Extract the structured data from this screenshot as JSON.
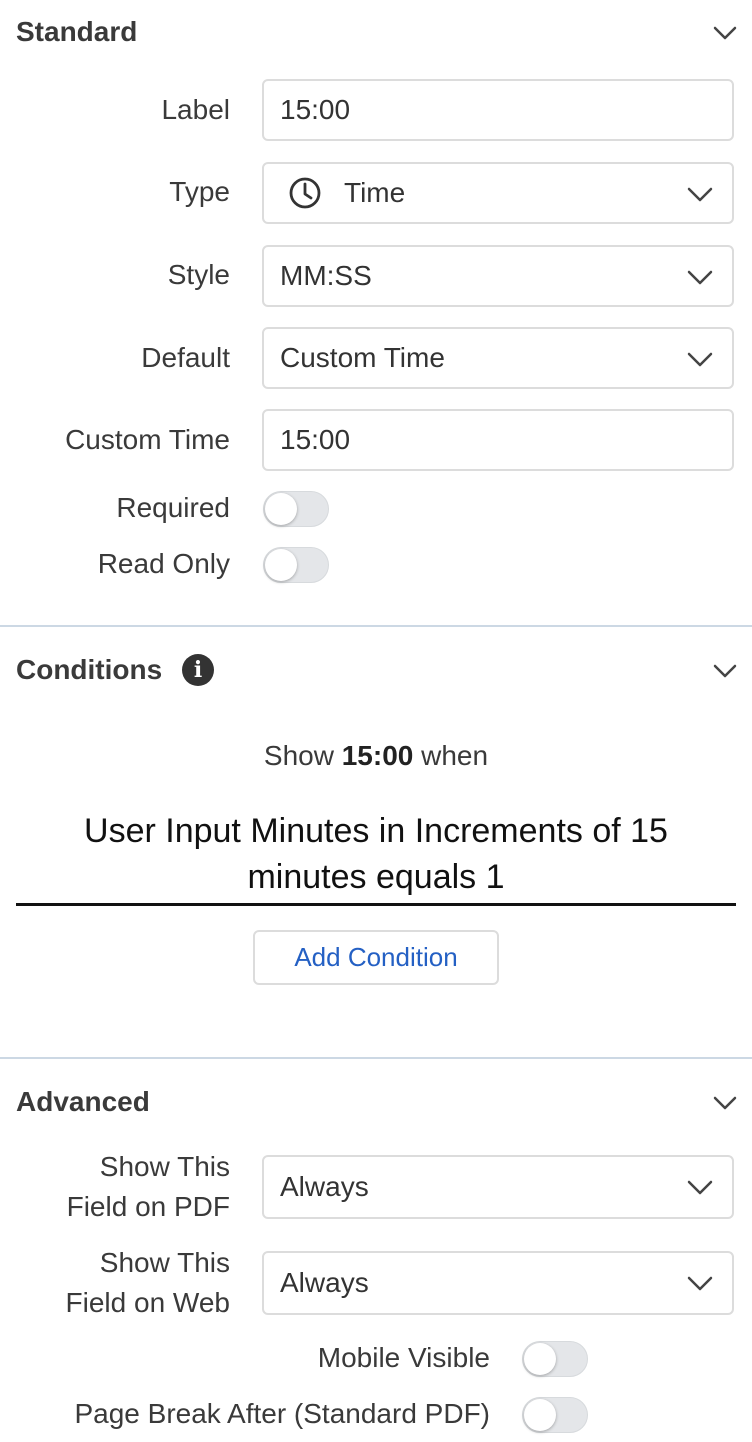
{
  "standard": {
    "title": "Standard",
    "label_label": "Label",
    "label_value": "15:00",
    "type_label": "Type",
    "type_value": "Time",
    "type_icon": "clock-icon",
    "style_label": "Style",
    "style_value": "MM:SS",
    "default_label": "Default",
    "default_value": "Custom Time",
    "custom_time_label": "Custom Time",
    "custom_time_value": "15:00",
    "required_label": "Required",
    "required_on": false,
    "read_only_label": "Read Only",
    "read_only_on": false
  },
  "conditions": {
    "title": "Conditions",
    "show_prefix": "Show",
    "show_field": "15:00",
    "show_suffix": "when",
    "rule_line1": "User Input Minutes in Increments of 15",
    "rule_line2": "minutes equals 1",
    "add_button": "Add Condition",
    "button_color": "#2460c4"
  },
  "advanced": {
    "title": "Advanced",
    "pdf_label_1": "Show This",
    "pdf_label_2": "Field on PDF",
    "pdf_value": "Always",
    "web_label_1": "Show This",
    "web_label_2": "Field on Web",
    "web_value": "Always",
    "mobile_label": "Mobile Visible",
    "mobile_on": false,
    "page_break_label": "Page Break After (Standard PDF)",
    "page_break_on": false
  }
}
